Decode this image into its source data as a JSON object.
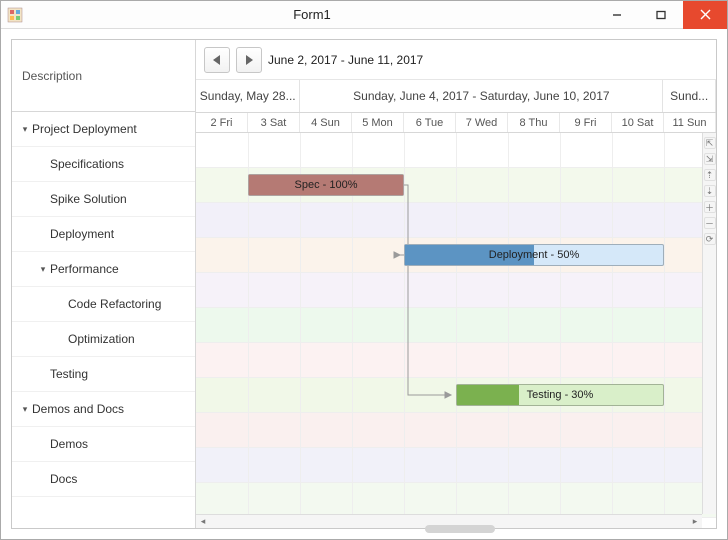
{
  "window": {
    "title": "Form1"
  },
  "sidebar": {
    "header": "Description",
    "items": [
      {
        "label": "Project Deployment",
        "indent": 0,
        "caret": true
      },
      {
        "label": "Specifications",
        "indent": 1,
        "caret": false
      },
      {
        "label": "Spike Solution",
        "indent": 1,
        "caret": false
      },
      {
        "label": "Deployment",
        "indent": 1,
        "caret": false
      },
      {
        "label": "Performance",
        "indent": 1,
        "caret": true
      },
      {
        "label": "Code Refactoring",
        "indent": 2,
        "caret": false
      },
      {
        "label": "Optimization",
        "indent": 2,
        "caret": false
      },
      {
        "label": "Testing",
        "indent": 1,
        "caret": false
      },
      {
        "label": "Demos and Docs",
        "indent": 0,
        "caret": true
      },
      {
        "label": "Demos",
        "indent": 1,
        "caret": false
      },
      {
        "label": "Docs",
        "indent": 1,
        "caret": false
      }
    ]
  },
  "toolbar": {
    "date_range": "June 2, 2017 - June 11, 2017"
  },
  "timeline": {
    "groups": [
      {
        "label": "Sunday, May 28...",
        "span": 2
      },
      {
        "label": "Sunday, June 4, 2017 - Saturday, June 10, 2017",
        "span": 7
      },
      {
        "label": "Sund...",
        "span": 1
      }
    ],
    "days": [
      {
        "label": "2 Fri"
      },
      {
        "label": "3 Sat"
      },
      {
        "label": "4 Sun"
      },
      {
        "label": "5 Mon"
      },
      {
        "label": "6 Tue"
      },
      {
        "label": "7 Wed"
      },
      {
        "label": "8 Thu"
      },
      {
        "label": "9 Fri"
      },
      {
        "label": "10 Sat"
      },
      {
        "label": "11 Sun"
      }
    ],
    "row_tints": [
      "#ffffff",
      "#f3f9ec",
      "#f2f0f9",
      "#fbf3eb",
      "#f6f2f9",
      "#edf9ed",
      "#fcf2f2",
      "#f1f8e8",
      "#faf0ef",
      "#f1f1f9",
      "#f3f9f0"
    ],
    "bars": [
      {
        "row": 1,
        "startCol": 1,
        "endCol": 4,
        "label": "Spec - 100%",
        "cls": "bar-spec",
        "progress": 100
      },
      {
        "row": 3,
        "startCol": 4,
        "endCol": 9,
        "label": "Deployment - 50%",
        "cls": "bar-deploy",
        "progress": 50
      },
      {
        "row": 7,
        "startCol": 5,
        "endCol": 9,
        "label": "Testing - 30%",
        "cls": "bar-test",
        "progress": 30
      }
    ]
  }
}
